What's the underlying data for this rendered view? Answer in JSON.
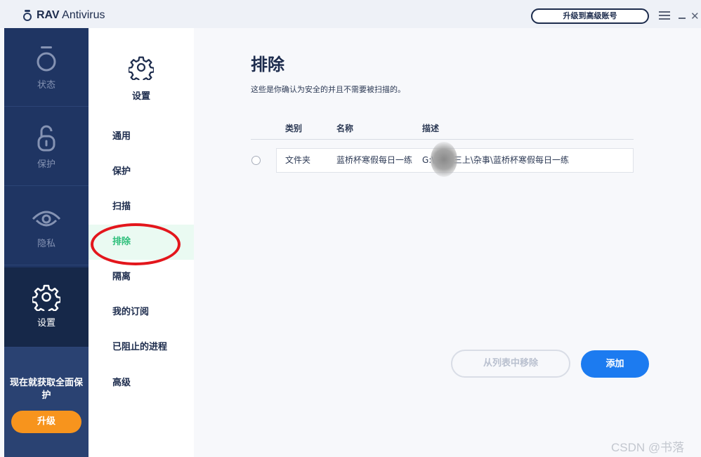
{
  "app": {
    "brand_bold": "RAV",
    "brand_rest": " Antivirus",
    "upgrade_account_label": "升级到高级账号"
  },
  "main_nav": [
    {
      "label": "状态",
      "icon": "status-ring-icon"
    },
    {
      "label": "保护",
      "icon": "lock-icon"
    },
    {
      "label": "隐私",
      "icon": "eye-icon"
    },
    {
      "label": "设置",
      "icon": "gear-icon",
      "active": true
    }
  ],
  "promo": {
    "text": "现在就获取全面保护",
    "button": "升级"
  },
  "settings_nav": {
    "title": "设置",
    "items": [
      {
        "label": "通用"
      },
      {
        "label": "保护"
      },
      {
        "label": "扫描"
      },
      {
        "label": "排除",
        "active": true
      },
      {
        "label": "隔离"
      },
      {
        "label": "我的订阅"
      },
      {
        "label": "已阻止的进程"
      },
      {
        "label": "高级"
      }
    ]
  },
  "page": {
    "title": "排除",
    "description": "这些是你确认为安全的并且不需要被扫描的。",
    "columns": {
      "type": "类别",
      "name": "名称",
      "description": "描述"
    },
    "rows": [
      {
        "type": "文件夹",
        "name": "蓝桥杯寒假每日一练",
        "description": "G:\\...\\大三上\\杂事\\蓝桥杯寒假每日一练"
      }
    ],
    "remove_button": "从列表中移除",
    "add_button": "添加"
  },
  "watermark": "CSDN @书落",
  "colors": {
    "nav_bg": "#1f3563",
    "accent_green": "#2ebf7b",
    "primary_blue": "#1c7bf0",
    "upgrade_orange": "#f7941d",
    "annotation_red": "#e3161c"
  }
}
